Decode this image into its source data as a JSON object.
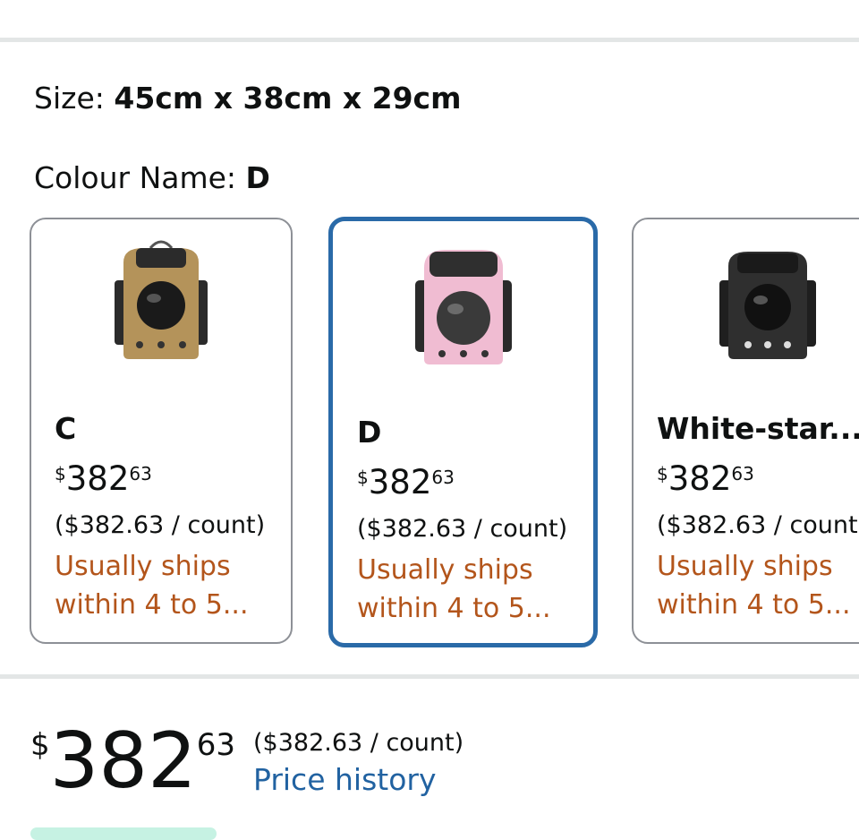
{
  "size": {
    "label": "Size:",
    "value": "45cm x 38cm x 29cm"
  },
  "colour": {
    "label": "Colour Name:",
    "value": "D"
  },
  "options": [
    {
      "name": "C",
      "currency": "$",
      "whole": "382",
      "fraction": "63",
      "unit_price": "($382.63 / count)",
      "shipping": "Usually ships within 4 to 5...",
      "icon": "tan-pet-carrier-backpack",
      "color": "#b4935a"
    },
    {
      "name": "D",
      "currency": "$",
      "whole": "382",
      "fraction": "63",
      "unit_price": "($382.63 / count)",
      "shipping": "Usually ships within 4 to 5...",
      "icon": "pink-pet-carrier-backpack",
      "color": "#f0bcd2"
    },
    {
      "name": "White-star...",
      "currency": "$",
      "whole": "382",
      "fraction": "63",
      "unit_price": "($382.63 / count)",
      "shipping": "Usually ships within 4 to 5...",
      "icon": "black-pet-carrier-backpack",
      "color": "#2f2f2f"
    }
  ],
  "selected_option": "D",
  "price": {
    "currency": "$",
    "whole": "382",
    "fraction": "63",
    "unit_price": "($382.63 / count)",
    "history_link": "Price history"
  },
  "colors": {
    "selected_border": "#2a6aa8",
    "shipping_text": "#b3551b",
    "link": "#2162a1"
  }
}
